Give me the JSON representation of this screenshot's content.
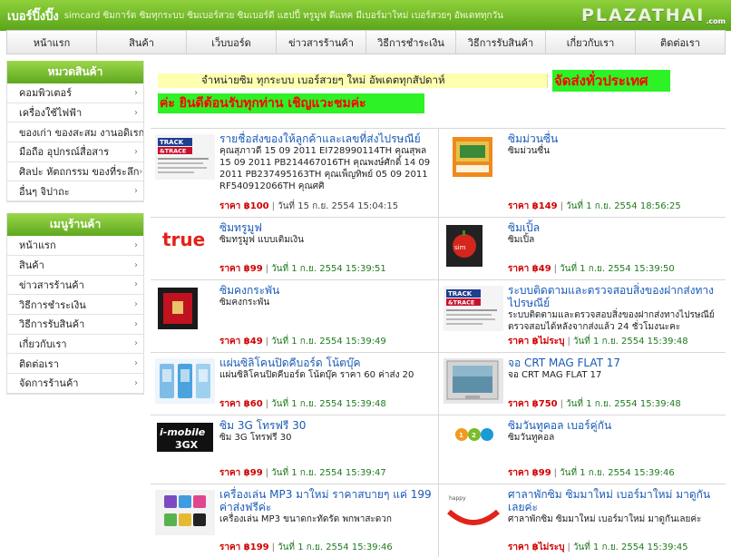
{
  "header": {
    "title": "เบอร์ปิ๊งปิ๊ง",
    "tagline": "simcard ซิมการ์ด ซิมทุกระบบ ซิมเบอร์สวย ซิมเบอร์ดี แฮปปี้ ทรูมูฟ ดีแทค มีเบอร์มาใหม่ เบอร์สวยๆ อัพเดททุกวัน",
    "logo": "PLAZATHAI",
    "logo_suffix": ".com"
  },
  "nav": [
    "หน้าแรก",
    "สินค้า",
    "เว็บบอร์ด",
    "ข่าวสารร้านค้า",
    "วิธีการชำระเงิน",
    "วิธีการรับสินค้า",
    "เกี่ยวกับเรา",
    "ติดต่อเรา"
  ],
  "sidebar": {
    "categories_title": "หมวดสินค้า",
    "categories": [
      "คอมพิวเตอร์",
      "เครื่องใช้ไฟฟ้า",
      "ของเก่า ของสะสม งานอดิเรก",
      "มือถือ อุปกรณ์สื่อสาร",
      "ศิลปะ หัตถกรรม ของที่ระลึก",
      "อื่นๆ จิปาถะ"
    ],
    "menu_title": "เมนูร้านค้า",
    "menu": [
      "หน้าแรก",
      "สินค้า",
      "ข่าวสารร้านค้า",
      "วิธีการชำระเงิน",
      "วิธีการรับสินค้า",
      "เกี่ยวกับเรา",
      "ติดต่อเรา",
      "จัดการร้านค้า"
    ]
  },
  "banner": {
    "line1": "จำหน่ายซิม ทุกระบบ เบอร์สวยๆ ใหม่ อัพเดตทุกสัปดาห์",
    "highlight1": "จัดส่งทั่วประเทศ",
    "highlight2": "ค่ะ ยินดีต้อนรับทุกท่าน เชิญแวะชมค่ะ"
  },
  "products": [
    {
      "title": "รายชื่อส่งของให้ลูกค้าและเลขที่ส่งไปรษณีย์",
      "desc": "คุณสุภาวดี 15 09 2011 EI728990114TH คุณสุพล 15 09 2011 PB214467016TH คุณพงษ์ศักดิ์ 14 09 2011 PB237495163TH คุณเพ็ญทิพย์ 05 09 2011 RF540912066TH คุณศศิ",
      "price": "ราคา ฿100",
      "date": "วันที่ 15 ก.ย. 2554 15:04:15",
      "icon": "track-and-trace-icon"
    },
    {
      "title": "ซิมม่วนซื่น",
      "desc": "ซิมม่วนซื่น",
      "price": "ราคา ฿149",
      "date": "วันที่ 1 ก.ย. 2554 18:56:25",
      "icon": "sim-package-icon"
    },
    {
      "title": "ซิมทรูมูฟ",
      "desc": "ซิมทรูมูฟ แบบเติมเงิน",
      "price": "ราคา ฿99",
      "date": "วันที่ 1 ก.ย. 2554 15:39:51",
      "icon": "true-logo"
    },
    {
      "title": "ซิมเปิ้ล",
      "desc": "ซิมเปิ้ล",
      "price": "ราคา ฿49",
      "date": "วันที่ 1 ก.ย. 2554 15:39:50",
      "icon": "apple-sim-icon"
    },
    {
      "title": "ซิมคงกระพัน",
      "desc": "ซิมคงกระพัน",
      "price": "ราคา ฿49",
      "date": "วันที่ 1 ก.ย. 2554 15:39:49",
      "icon": "red-sim-card-icon"
    },
    {
      "title": "ระบบติดตามและตรวจสอบสิ่งของฝากส่งทางไปรษณีย์",
      "desc": "ระบบติดตามและตรวจสอบสิ่งของฝากส่งทางไปรษณีย์ ตรวจสอบได้หลังจากส่งแล้ว 24 ชั่วโมงนะคะ",
      "price": "ราคา ฿ไม่ระบุ",
      "date": "วันที่ 1 ก.ย. 2554 15:39:48",
      "icon": "track-and-trace-icon"
    },
    {
      "title": "แผ่นซิลิโคนปิดคีบอร์ด โน้ตบุ๊ค",
      "desc": "แผ่นซิลิโคนปิดคีบอร์ด โน้ตบุ๊ค ราคา 60 ค่าส่ง 20",
      "price": "ราคา ฿60",
      "date": "วันที่ 1 ก.ย. 2554 15:39:48",
      "icon": "silicone-cover-icon"
    },
    {
      "title": "จอ CRT MAG FLAT 17",
      "desc": "จอ CRT MAG FLAT 17",
      "price": "ราคา ฿750",
      "date": "วันที่ 1 ก.ย. 2554 15:39:48",
      "icon": "crt-monitor-icon"
    },
    {
      "title": "ซิม 3G โทรฟรี 30",
      "desc": "ซิม 3G โทรฟรี 30",
      "price": "ราคา ฿99",
      "date": "วันที่ 1 ก.ย. 2554 15:39:47",
      "icon": "imobile-3gx-logo"
    },
    {
      "title": "ซิมวันทูคอล เบอร์คู่กัน",
      "desc": "ซิมวันทูคอล",
      "price": "ราคา ฿99",
      "date": "วันที่ 1 ก.ย. 2554 15:39:46",
      "icon": "12call-logo"
    },
    {
      "title": "เครื่องเล่น MP3 มาใหม่ ราคาสบายๆ แค่ 199 ค่าส่งฟรีค่ะ",
      "desc": "เครื่องเล่น MP3 ขนาดกะทัดรัด พกพาสะดวก",
      "price": "ราคา ฿199",
      "date": "วันที่ 1 ก.ย. 2554 15:39:46",
      "icon": "mp3-player-icon"
    },
    {
      "title": "ศาลาพักซิม ซิมมาใหม่ เบอร์มาใหม่ มาดูกันเลยค่ะ",
      "desc": "ศาลาพักซิม ซิมมาใหม่ เบอร์มาใหม่ มาดูกันเลยค่ะ",
      "price": "ราคา ฿ไม่ระบุ",
      "date": "วันที่ 1 ก.ย. 2554 15:39:45",
      "icon": "happy-sim-icon"
    }
  ],
  "colors": {
    "header_green": "#6db528",
    "price_red": "#d20000",
    "link_blue": "#1a5ab8",
    "banner_green": "#2df226",
    "banner_yellow": "#ffffb0"
  }
}
